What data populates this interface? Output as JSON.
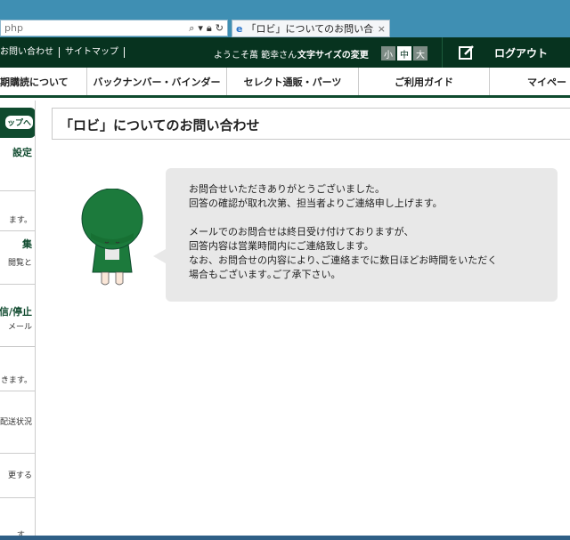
{
  "browser": {
    "url_fragment": "php",
    "tab_title": "「ロビ」についてのお問い合わせ ...",
    "tab_close": "×"
  },
  "topbar": {
    "links": [
      "お問い合わせ",
      "サイトマップ"
    ],
    "welcome": "ようこそ萬 範幸さん",
    "fontsize_label": "文字サイズの変更",
    "sizes": [
      "小",
      "中",
      "大"
    ],
    "logout": "ログアウト"
  },
  "nav": {
    "items": [
      "期購読について",
      "バックナンバー・バインダー",
      "セレクト通販・パーツ",
      "ご利用ガイド",
      "マイペー"
    ]
  },
  "sidebar": {
    "tab_label": "ップへ",
    "items": [
      {
        "title": "設定",
        "sub": ""
      },
      {
        "title": "",
        "sub": "ます。"
      },
      {
        "title": "集",
        "sub": "閲覧と"
      },
      {
        "title": "信/停止",
        "sub": "メール"
      },
      {
        "title": "",
        "sub": "きます。"
      },
      {
        "title": "",
        "sub": "配送状況"
      },
      {
        "title": "",
        "sub": "更する"
      },
      {
        "title": "",
        "sub": "す。"
      }
    ]
  },
  "content": {
    "page_title": "「ロビ」についてのお問い合わせ",
    "message": {
      "para1": [
        "お問合せいただきありがとうございました。",
        "回答の確認が取れ次第、担当者よりご連絡申し上げます。"
      ],
      "para2": [
        "メールでのお問合せは終日受け付けておりますが、",
        "回答内容は営業時間内にご連絡致します。",
        "なお、お問合せの内容により､ご連絡までに数日ほどお時間をいただく",
        "場合もございます｡ご了承下さい。"
      ]
    }
  },
  "colors": {
    "brand_dark": "#07331f",
    "brand_green": "#0f4a2e",
    "bubble_bg": "#e8e8e8",
    "mascot_green": "#1c7a3c"
  }
}
